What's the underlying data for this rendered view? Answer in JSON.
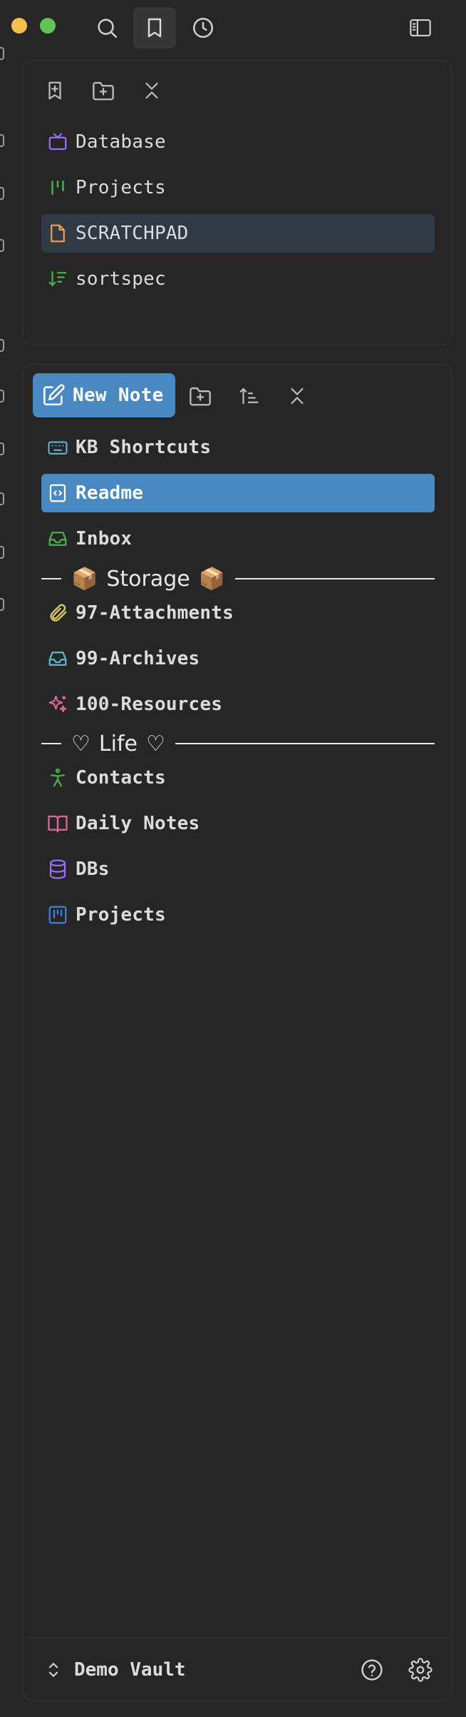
{
  "titlebar": {
    "tabs": [
      {
        "name": "search",
        "icon": "search-icon"
      },
      {
        "name": "bookmarks",
        "icon": "bookmark-icon",
        "active": true
      },
      {
        "name": "recent",
        "icon": "clock-icon"
      }
    ],
    "sidebar_toggle_icon": "sidebar-toggle-icon"
  },
  "bookmarks": {
    "toolbar": [
      "bookmark-add-icon",
      "folder-plus-icon",
      "collapse-all-icon"
    ],
    "items": [
      {
        "label": "Database",
        "icon": "tv-icon",
        "color": "#9b6ef3"
      },
      {
        "label": "Projects",
        "icon": "kanban-icon",
        "color": "#4cae4f"
      },
      {
        "label": "SCRATCHPAD",
        "icon": "file-icon",
        "color": "#e6a04a",
        "selected": true
      },
      {
        "label": "sortspec",
        "icon": "sort-desc-icon",
        "color": "#4cae4f"
      }
    ]
  },
  "explorer": {
    "new_note_label": "New Note",
    "toolbar": [
      "folder-plus-icon",
      "sort-icon",
      "collapse-all-icon"
    ],
    "items": [
      {
        "label": "KB Shortcuts",
        "icon": "keyboard-icon",
        "color": "#5fb8c9"
      },
      {
        "label": "Readme",
        "icon": "file-code-icon",
        "color": "#ffffff",
        "selected": true
      },
      {
        "label": "Inbox",
        "icon": "inbox-icon",
        "color": "#4cae4f"
      }
    ],
    "storage_divider": {
      "label": "Storage",
      "emoji": "📦"
    },
    "storage_items": [
      {
        "label": "97-Attachments",
        "icon": "paperclip-icon",
        "color": "#d8c660"
      },
      {
        "label": "99-Archives",
        "icon": "inbox-icon",
        "color": "#5fb8c9"
      },
      {
        "label": "100-Resources",
        "icon": "sparkles-icon",
        "color": "#e0679a"
      }
    ],
    "life_divider": {
      "label": "Life",
      "emoji": "♡"
    },
    "life_items": [
      {
        "label": "Contacts",
        "icon": "person-icon",
        "color": "#4cae4f"
      },
      {
        "label": "Daily Notes",
        "icon": "book-open-icon",
        "color": "#e0679a"
      },
      {
        "label": "DBs",
        "icon": "database-icon",
        "color": "#9b6ef3"
      },
      {
        "label": "Projects",
        "icon": "kanban-icon",
        "color": "#3f7fdd"
      }
    ]
  },
  "footer": {
    "vault_name": "Demo Vault",
    "help_icon": "help-icon",
    "settings_icon": "gear-icon"
  },
  "colors": {
    "background": "#262626",
    "accent": "#4a88c2",
    "selected_dark": "#2f3a45"
  }
}
